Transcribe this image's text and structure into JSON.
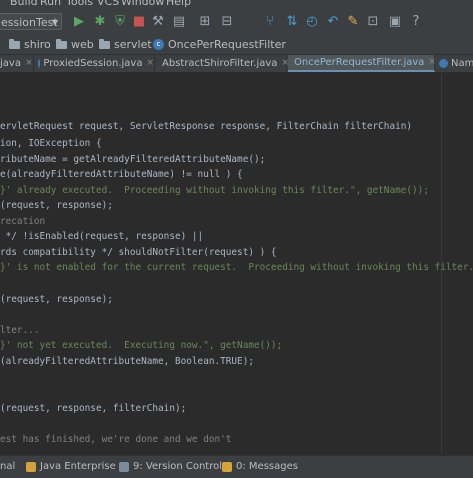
{
  "menu": {
    "items": [
      "Build",
      "Run",
      "Tools",
      "VCS",
      "Window",
      "Help"
    ]
  },
  "toolbar": {
    "run_config": "essionTest",
    "colors": {
      "run": "#59a869",
      "debug": "#59a869",
      "accent": "#4a9fd8"
    },
    "icons": [
      "run-icon",
      "debug-icon",
      "coverage-icon",
      "stop-icon",
      "make-icon",
      "build-icon",
      "tree-icon",
      "branch-icon",
      "sync-icon",
      "undo-icon",
      "settings-icon",
      "structure-icon",
      "help-icon"
    ]
  },
  "navbar": {
    "crumbs": [
      "shiro",
      "web",
      "servlet",
      "OncePerRequestFilter"
    ]
  },
  "tabs": [
    {
      "label": "java"
    },
    {
      "label": "ProxiedSession.java"
    },
    {
      "label": "AbstractShiroFilter.java"
    },
    {
      "label": "OncePerRequestFilter.java",
      "active": true
    },
    {
      "label": "Nam"
    }
  ],
  "code": {
    "lines": [
      "ervletRequest request, ServletResponse response, FilterChain filterChain)",
      "ion, IOException {",
      "ributeName = getAlreadyFilteredAttributeName();",
      "e(alreadyFilteredAttributeName) != null ) {",
      "}' already executed.  Proceeding without invoking this filter.\", getName());",
      "(request, response);",
      "recation",
      " */ !isEnabled(request, response) ||",
      "rds compatibility */ shouldNotFilter(request) ) {",
      "}' is not enabled for the current request.  Proceeding without invoking this filter.\",",
      "(request, response);",
      "lter...",
      "}' not yet executed.  Executing now.\", getName());",
      "(alreadyFilteredAttributeName, Boolean.TRUE);",
      "(request, response, filterChain);",
      "est has finished, we're done and we don't"
    ]
  },
  "statusbar": {
    "items": [
      "nal",
      "Java Enterprise",
      "9: Version Control",
      "0: Messages"
    ]
  }
}
